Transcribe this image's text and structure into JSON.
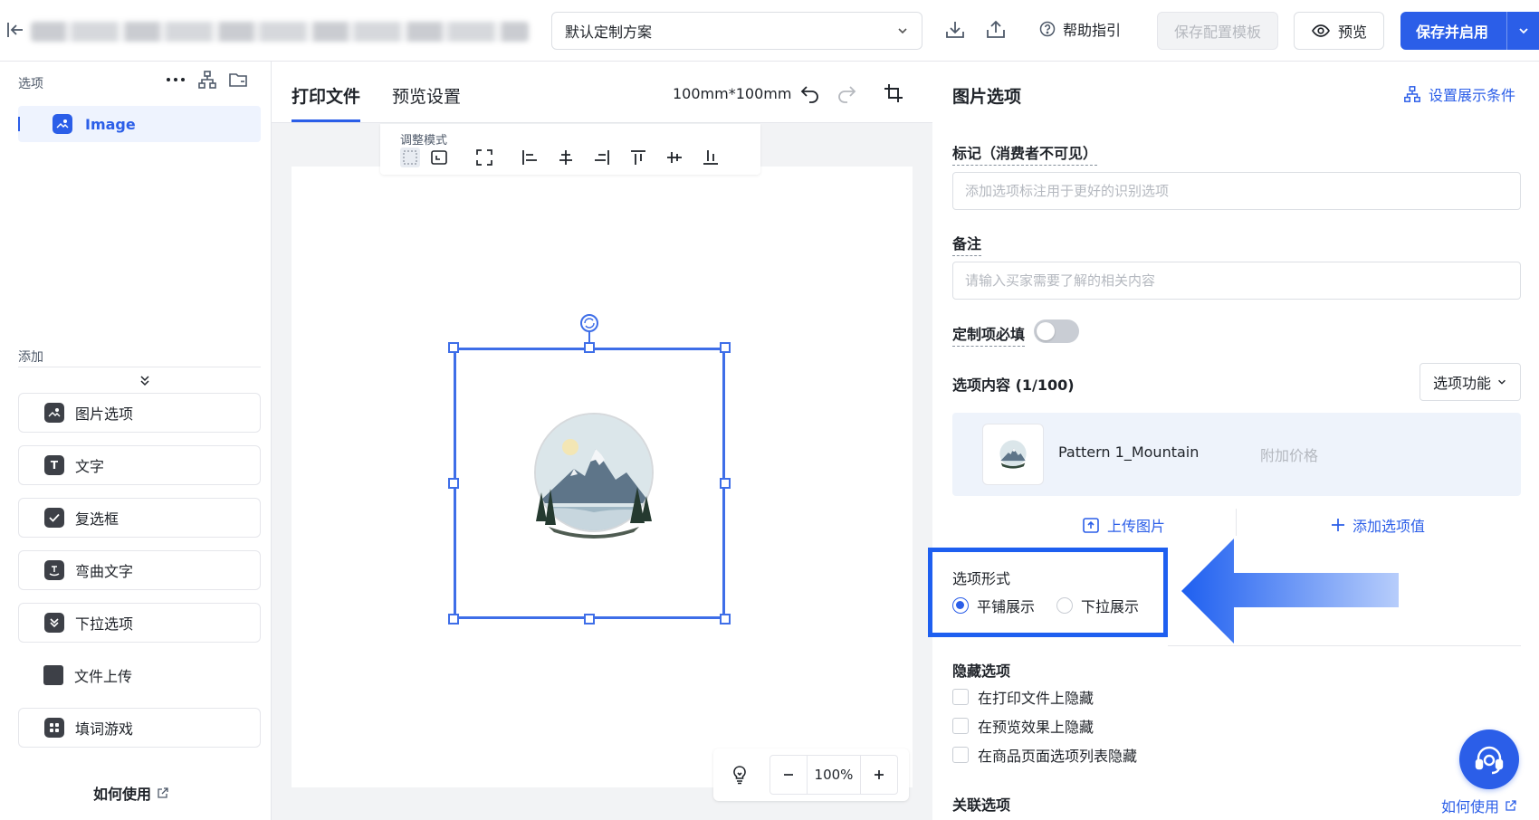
{
  "topbar": {
    "scheme_select": "默认定制方案",
    "help": "帮助指引",
    "save_template": "保存配置模板",
    "preview": "预览",
    "save_enable": "保存并启用"
  },
  "left": {
    "options_label": "选项",
    "layer_item": "Image",
    "add_label": "添加",
    "add_items": [
      "图片选项",
      "文字",
      "复选框",
      "弯曲文字",
      "下拉选项",
      "文件上传",
      "填词游戏"
    ],
    "howto": "如何使用"
  },
  "center": {
    "tabs": [
      "打印文件",
      "预览设置"
    ],
    "dimensions": "100mm*100mm",
    "adjust_mode": "调整模式",
    "zoom": "100%"
  },
  "right": {
    "title": "图片选项",
    "display_condition": "设置展示条件",
    "mark_label": "标记（消费者不可见）",
    "mark_placeholder": "添加选项标注用于更好的识别选项",
    "note_label": "备注",
    "note_placeholder": "请输入买家需要了解的相关内容",
    "required_label": "定制项必填",
    "required_on": false,
    "content_header": "选项内容 (1/100)",
    "option_function": "选项功能",
    "option_name": "Pattern 1_Mountain",
    "extra_price_placeholder": "附加价格",
    "upload_image": "上传图片",
    "add_value": "添加选项值",
    "form_label": "选项形式",
    "form_options": [
      "平铺展示",
      "下拉展示"
    ],
    "form_selected": "平铺展示",
    "hide_header": "隐藏选项",
    "hide_options": [
      "在打印文件上隐藏",
      "在预览效果上隐藏",
      "在商品页面选项列表隐藏"
    ],
    "association_header": "关联选项",
    "howto": "如何使用"
  },
  "colors": {
    "accent": "#2b5ee8",
    "highlight": "#1e5ff0"
  }
}
